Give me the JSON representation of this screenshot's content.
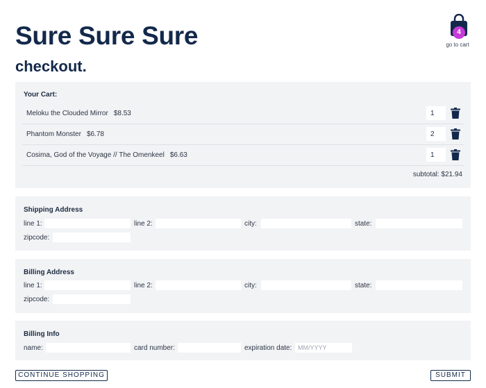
{
  "header": {
    "store_title": "Sure Sure Sure",
    "page_heading": "checkout.",
    "cart": {
      "count": "4",
      "link_label": "go to cart",
      "badge_color": "#c73bd8"
    }
  },
  "cart": {
    "title": "Your Cart:",
    "items": [
      {
        "name": "Meloku the Clouded Mirror",
        "price": "$8.53",
        "quantity": "1"
      },
      {
        "name": "Phantom Monster",
        "price": "$6.78",
        "quantity": "2"
      },
      {
        "name": "Cosima, God of the Voyage // The Omenkeel",
        "price": "$6.63",
        "quantity": "1"
      }
    ],
    "subtotal": "subtotal: $21.94"
  },
  "shipping": {
    "title": "Shipping Address",
    "line1_label": "line 1:",
    "line2_label": "line 2:",
    "city_label": "city:",
    "state_label": "state:",
    "zipcode_label": "zipcode:"
  },
  "billing": {
    "title": "Billing Address",
    "line1_label": "line 1:",
    "line2_label": "line 2:",
    "city_label": "city:",
    "state_label": "state:",
    "zipcode_label": "zipcode:"
  },
  "billing_info": {
    "title": "Billing Info",
    "name_label": "name:",
    "card_label": "card number:",
    "expiration_label": "expiration date:",
    "expiration_placeholder": "MM/YYYY"
  },
  "actions": {
    "continue_label": "CONTINUE SHOPPING",
    "submit_label": "SUBMIT"
  },
  "colors": {
    "heading": "#13294b",
    "panel_bg": "#f2f3f5",
    "accent": "#c73bd8"
  }
}
